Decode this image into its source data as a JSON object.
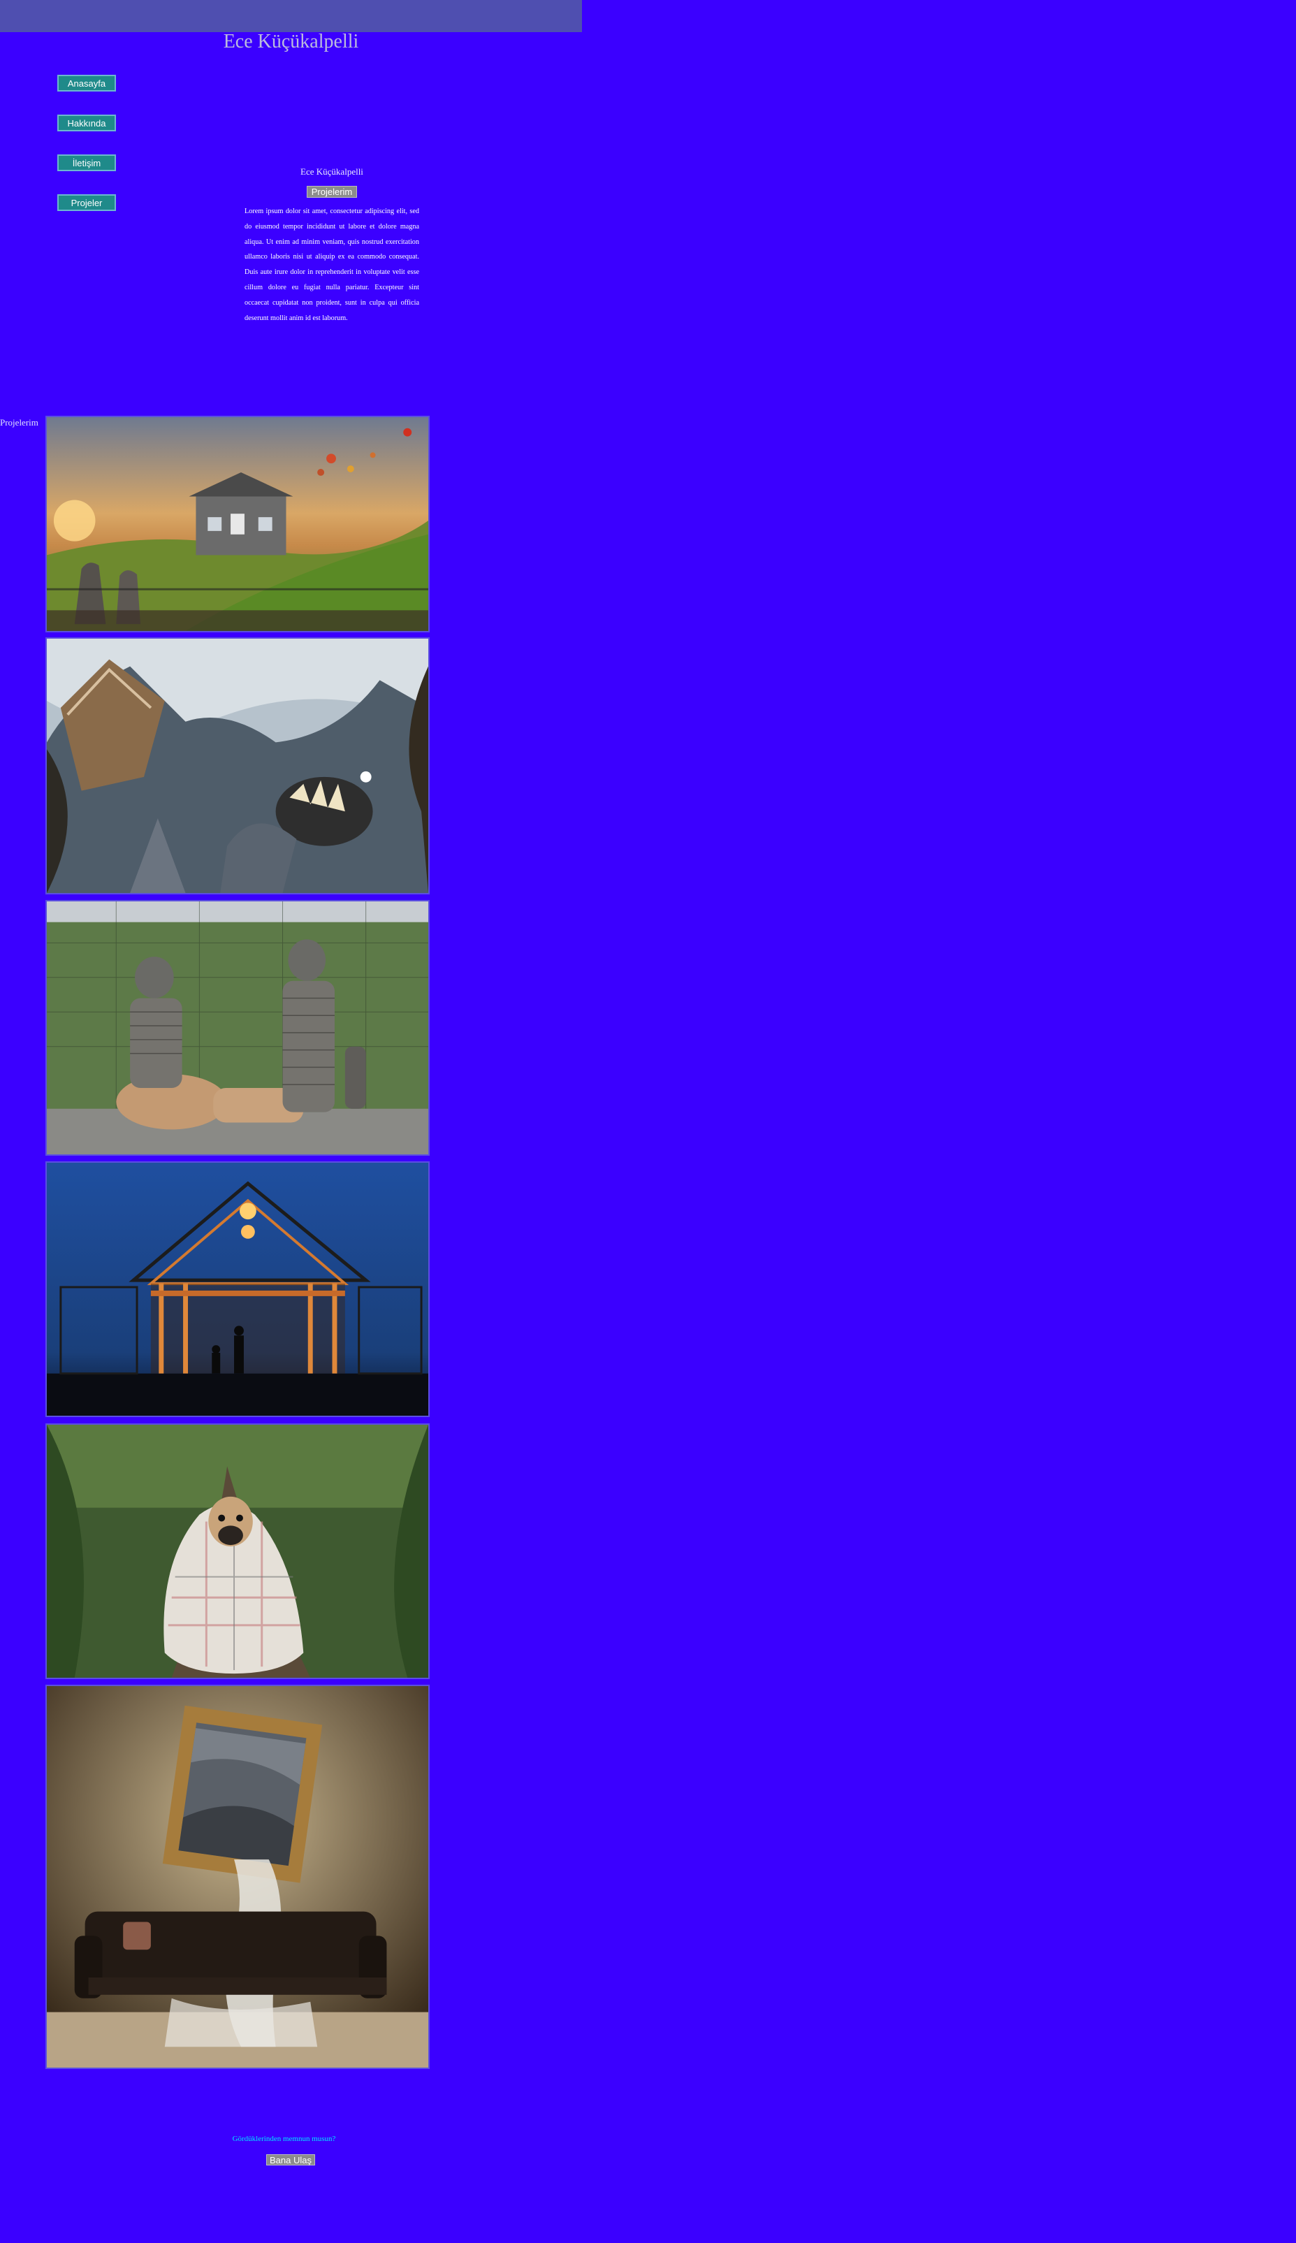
{
  "header": {
    "site_title": "Ece Küçükalpelli"
  },
  "nav": {
    "items": [
      {
        "label": "Anasayfa"
      },
      {
        "label": "Hakkında"
      },
      {
        "label": "İletişim"
      },
      {
        "label": "Projeler"
      }
    ]
  },
  "about": {
    "name": "Ece Küçükalpelli",
    "button_label": "Projelerim",
    "text": "Lorem ipsum dolor sit amet, consectetur adipiscing elit, sed do eiusmod tempor incididunt ut labore et dolore magna aliqua. Ut enim ad minim veniam, quis nostrud exercitation ullamco laboris nisi ut aliquip ex ea commodo consequat. Duis aute irure dolor in reprehenderit in voluptate velit esse cillum dolore eu fugiat nulla pariatur. Excepteur sint occaecat cupidatat non proident, sunt in culpa qui officia deserunt mollit anim id est laborum."
  },
  "projects": {
    "label": "Projelerim"
  },
  "cta": {
    "text": "Gördüklerinden memnun musun?",
    "button_label": "Bana Ulaş"
  },
  "colors": {
    "background": "#3b00ff",
    "topbar": "#4f4fb0",
    "nav_button": "#1f8a8a",
    "cta_text": "#00e6ff"
  }
}
